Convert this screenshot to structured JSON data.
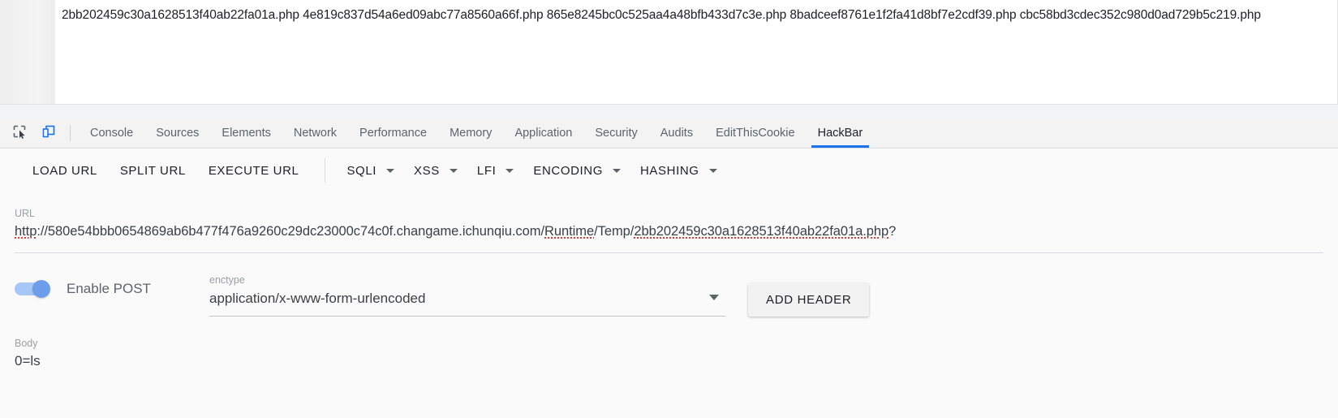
{
  "page": {
    "listing_text": "2bb202459c30a1628513f40ab22fa01a.php 4e819c837d54a6ed09abc77a8560a66f.php 865e8245bc0c525aa4a48bfb433d7c3e.php 8badceef8761e1f2fa41d8bf7e2cdf39.php cbc58bd3cdec352c980d0ad729b5c219.php"
  },
  "devtools": {
    "icons": {
      "inspect": "inspect-element-icon",
      "device": "device-toolbar-icon"
    },
    "tabs": [
      {
        "label": "Console",
        "active": false
      },
      {
        "label": "Sources",
        "active": false
      },
      {
        "label": "Elements",
        "active": false
      },
      {
        "label": "Network",
        "active": false
      },
      {
        "label": "Performance",
        "active": false
      },
      {
        "label": "Memory",
        "active": false
      },
      {
        "label": "Application",
        "active": false
      },
      {
        "label": "Security",
        "active": false
      },
      {
        "label": "Audits",
        "active": false
      },
      {
        "label": "EditThisCookie",
        "active": false
      },
      {
        "label": "HackBar",
        "active": true
      }
    ],
    "active_tab": "HackBar",
    "accent_color": "#1a73e8"
  },
  "hackbar": {
    "toolbar": {
      "load_url": "LOAD URL",
      "split_url": "SPLIT URL",
      "execute_url": "EXECUTE URL",
      "menus": [
        {
          "label": "SQLI"
        },
        {
          "label": "XSS"
        },
        {
          "label": "LFI"
        },
        {
          "label": "ENCODING"
        },
        {
          "label": "HASHING"
        }
      ]
    },
    "url": {
      "caption": "URL",
      "prefix": "http",
      "mid": "://580e54bbb0654869ab6b477f476a9260c29dc23000c74c0f.changame.ichunqiu.com/",
      "seg_runtime": "Runtime",
      "seg_temp": "/Temp/",
      "seg_file": "2bb202459c30a1628513f40ab22fa01a.php",
      "suffix": "?",
      "full_value": "http://580e54bbb0654869ab6b477f476a9260c29dc23000c74c0f.changame.ichunqiu.com/Runtime/Temp/2bb202459c30a1628513f40ab22fa01a.php?"
    },
    "post": {
      "toggle_label": "Enable POST",
      "enabled": true,
      "toggle_color": "#6d9eeb"
    },
    "enctype": {
      "caption": "enctype",
      "value": "application/x-www-form-urlencoded"
    },
    "add_header": "ADD HEADER",
    "body": {
      "caption": "Body",
      "value": "0=ls"
    }
  }
}
